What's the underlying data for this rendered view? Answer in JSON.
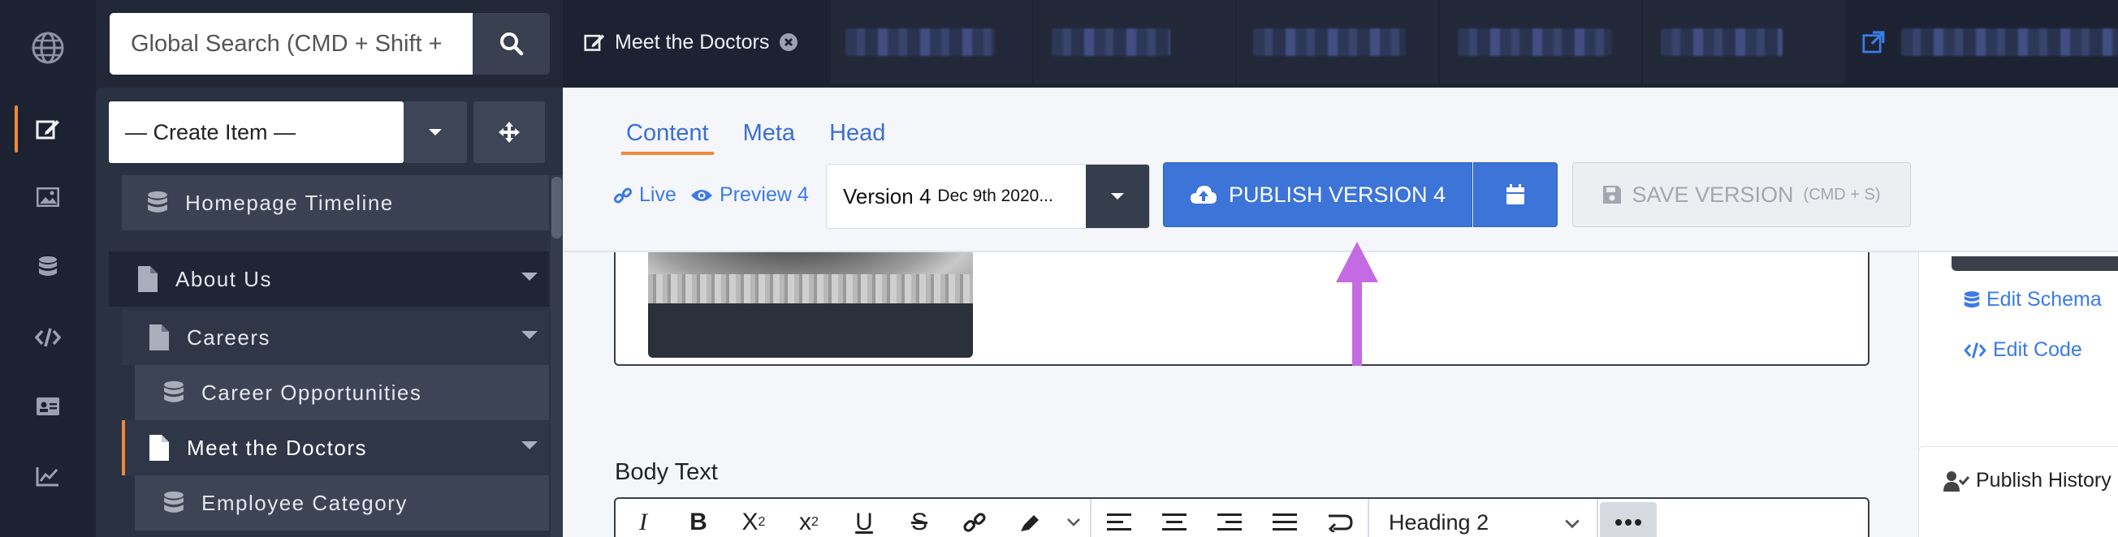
{
  "search": {
    "placeholder": "Global Search (CMD + Shift +"
  },
  "tabs_bar": {
    "active_tab_label": "Meet the Doctors"
  },
  "sidebar": {
    "create_label": "— Create Item —",
    "items": [
      {
        "label": "Homepage Timeline",
        "icon": "database-icon",
        "level": 1
      },
      {
        "label": "About Us",
        "icon": "file-icon",
        "level": 0,
        "expandable": true
      },
      {
        "label": "Careers",
        "icon": "file-icon",
        "level": 1,
        "expandable": true
      },
      {
        "label": "Career Opportunities",
        "icon": "database-icon",
        "level": 2
      },
      {
        "label": "Meet the Doctors",
        "icon": "file-icon",
        "level": 1,
        "expandable": true,
        "selected": true
      },
      {
        "label": "Employee Category",
        "icon": "database-icon",
        "level": 2
      }
    ]
  },
  "content_tabs": {
    "content": "Content",
    "meta": "Meta",
    "head": "Head"
  },
  "links": {
    "live": "Live",
    "preview": "Preview 4"
  },
  "version": {
    "label": "Version 4",
    "date": "Dec 9th 2020..."
  },
  "actions": {
    "publish": "PUBLISH VERSION 4",
    "save": "SAVE VERSION",
    "save_hint": "(CMD + S)"
  },
  "editor": {
    "body_label": "Body Text",
    "heading_value": "Heading 2"
  },
  "right_panel": {
    "edit_schema": "Edit Schema",
    "edit_code": "Edit Code",
    "publish_history": "Publish History"
  },
  "colors": {
    "accent": "#f0893a",
    "primary": "#3c74d8",
    "arrow": "#c46be3"
  }
}
